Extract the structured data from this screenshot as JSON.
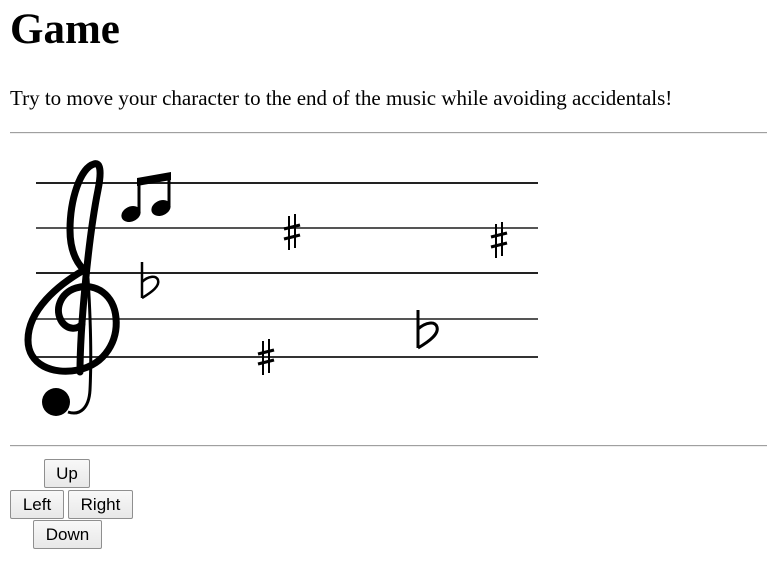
{
  "title": "Game",
  "instructions": "Try to move your character to the end of the music while avoiding accidentals!",
  "staff": {
    "clef_icon": "treble-clef-icon",
    "player_icon": "beamed-eighth-notes-icon",
    "accidental_icons": [
      "flat-icon",
      "sharp-icon",
      "sharp-icon",
      "flat-icon",
      "sharp-icon"
    ]
  },
  "controls": {
    "up": "Up",
    "left": "Left",
    "right": "Right",
    "down": "Down"
  }
}
